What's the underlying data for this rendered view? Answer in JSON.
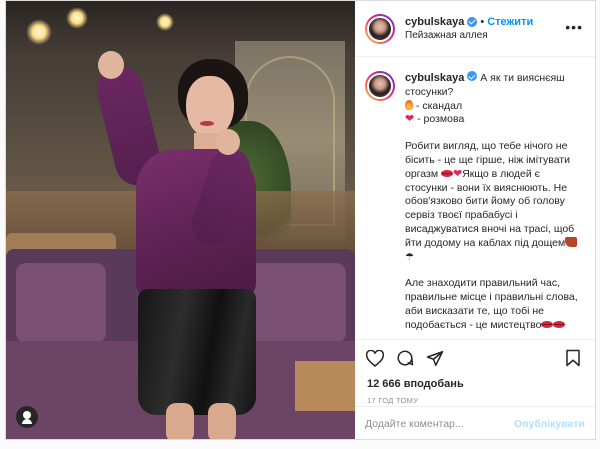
{
  "post": {
    "user": {
      "username": "cybulskaya",
      "verified": true,
      "follow_label": "Стежити",
      "location": "Пейзажная аллея"
    },
    "caption": {
      "lines_intro": [
        "А як ти вияснєяш",
        "стосунки?"
      ],
      "option_fire": "- скандал",
      "option_heart": "- розмова",
      "para1": "Робити вигляд, що тебе нічого не бісить - це ще гірше, ніж імітувати оргазм",
      "para1b": "Якщо в людей є стосунки - вони їх вияснюють. Не обов'язково бити йому об голову сервіз твоєї прабабусі і висаджуватися вночі на трасі, щоб йти додому на каблах під дощем",
      "para2": "Але знаходити правильний час, правильне місце і правильні слова, аби висказати те, що тобі не подобається - це мистецтво"
    },
    "likes": "12 666 вподобань",
    "time": "17 ГОД ТОМУ",
    "comment_placeholder": "Додайте коментар...",
    "publish_label": "Опублікувати",
    "icons": [
      "heart-icon",
      "comment-icon",
      "share-icon",
      "bookmark-icon",
      "more-icon",
      "user-tag-icon"
    ],
    "colors": {
      "link_blue": "#0095f6",
      "publish_disabled": "#b2dffc",
      "verified_blue": "#3897f0",
      "border": "#dbdbdb"
    }
  }
}
